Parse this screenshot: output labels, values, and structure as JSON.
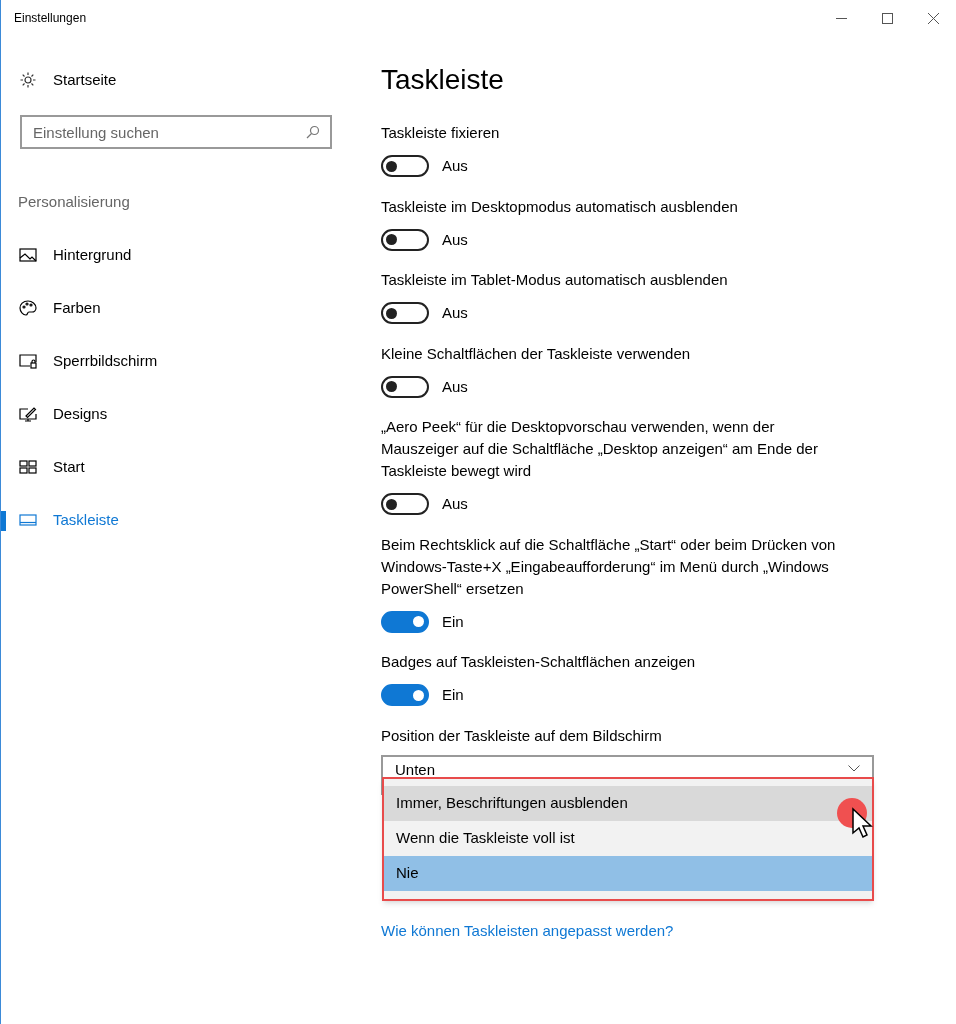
{
  "window": {
    "title": "Einstellungen"
  },
  "sidebar": {
    "home": "Startseite",
    "search": {
      "placeholder": "Einstellung suchen"
    },
    "section": "Personalisierung",
    "items": [
      {
        "label": "Hintergrund",
        "kind": "image",
        "selected": false
      },
      {
        "label": "Farben",
        "kind": "palette",
        "selected": false
      },
      {
        "label": "Sperrbildschirm",
        "kind": "lock",
        "selected": false
      },
      {
        "label": "Designs",
        "kind": "designs",
        "selected": false
      },
      {
        "label": "Start",
        "kind": "start",
        "selected": false
      },
      {
        "label": "Taskleiste",
        "kind": "taskbar",
        "selected": true
      }
    ]
  },
  "page": {
    "title": "Taskleiste",
    "settings": [
      {
        "label": "Taskleiste fixieren",
        "on": false,
        "state": "Aus"
      },
      {
        "label": "Taskleiste im Desktopmodus automatisch ausblenden",
        "on": false,
        "state": "Aus"
      },
      {
        "label": "Taskleiste im Tablet-Modus automatisch ausblenden",
        "on": false,
        "state": "Aus"
      },
      {
        "label": "Kleine Schaltflächen der Taskleiste verwenden",
        "on": false,
        "state": "Aus"
      },
      {
        "label": "„Aero Peek“ für die Desktopvorschau verwenden, wenn der Mauszeiger auf die Schaltfläche „Desktop anzeigen“ am Ende der Taskleiste bewegt wird",
        "on": false,
        "state": "Aus"
      },
      {
        "label": "Beim Rechtsklick auf die Schaltfläche „Start“ oder beim Drücken von Windows-Taste+X „Eingabeaufforderung“ im Menü durch „Windows PowerShell“ ersetzen",
        "on": true,
        "state": "Ein"
      },
      {
        "label": "Badges auf Taskleisten-Schaltflächen anzeigen",
        "on": true,
        "state": "Ein"
      }
    ],
    "position": {
      "label": "Position der Taskleiste auf dem Bildschirm",
      "value": "Unten"
    },
    "menu": [
      {
        "label": "Immer, Beschriftungen ausblenden",
        "hovered": true,
        "selected": false
      },
      {
        "label": "Wenn die Taskleiste voll ist",
        "hovered": false,
        "selected": false
      },
      {
        "label": "Nie",
        "hovered": false,
        "selected": true
      }
    ],
    "link": "Wie können Taskleisten angepasst werden?"
  }
}
